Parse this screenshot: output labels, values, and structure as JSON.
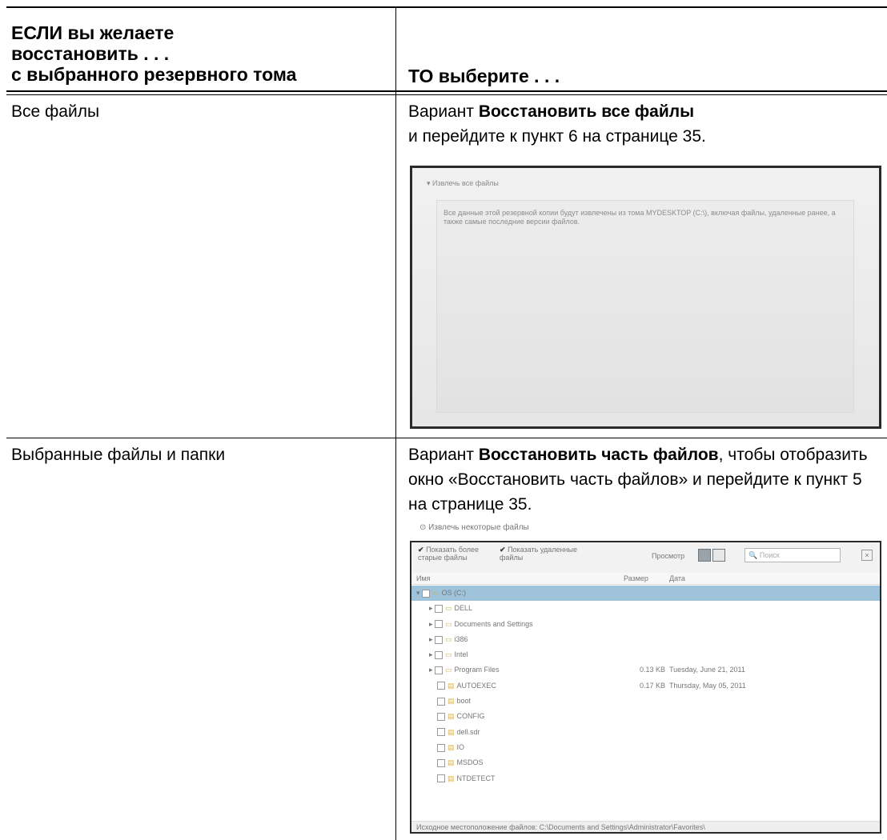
{
  "header": {
    "left_lines": [
      "ЕСЛИ вы желаете",
      "восстановить . . .",
      "с выбранного резервного тома"
    ],
    "right": "ТО выберите . . ."
  },
  "rows": [
    {
      "left": "Все файлы",
      "right_prefix": "Вариант ",
      "right_bold": "Восстановить все файлы",
      "right_suffix": "и перейдите к пункт 6 на странице 35."
    },
    {
      "left": "Выбранные файлы и папки",
      "right_prefix": "Вариант ",
      "right_bold": "Восстановить часть файлов",
      "right_suffix": ", чтобы отобразить окно «Восстановить часть файлов» и перейдите к пункт 5 на странице 35."
    }
  ],
  "screenshot_all": {
    "title": "Извлечь все файлы",
    "description": "Все данные этой резервной копии будут извлечены из тома MYDESKTOP (C:\\), включая файлы, удаленные ранее, а также самые последние версии файлов."
  },
  "screenshot_some": {
    "title": "Извлечь некоторые файлы",
    "checkbox_old": "Показать более старые файлы",
    "checkbox_deleted": "Показать удаленные файлы",
    "view_label": "Просмотр",
    "search_placeholder": "Поиск",
    "col_name": "Имя",
    "col_size": "Размер",
    "col_date": "Дата",
    "rows": [
      {
        "name": "OS (C:)",
        "size": "",
        "date": ""
      },
      {
        "name": "DELL",
        "size": "",
        "date": ""
      },
      {
        "name": "Documents and Settings",
        "size": "",
        "date": ""
      },
      {
        "name": "i386",
        "size": "",
        "date": ""
      },
      {
        "name": "Intel",
        "size": "",
        "date": ""
      },
      {
        "name": "Program Files",
        "size": "0.13 KB",
        "date": "Tuesday, June 21, 2011"
      },
      {
        "name": "AUTOEXEC",
        "size": "0.17 KB",
        "date": "Thursday, May 05, 2011"
      },
      {
        "name": "boot",
        "size": "",
        "date": ""
      },
      {
        "name": "CONFIG",
        "size": "",
        "date": ""
      },
      {
        "name": "dell.sdr",
        "size": "",
        "date": ""
      },
      {
        "name": "IO",
        "size": "",
        "date": ""
      },
      {
        "name": "MSDOS",
        "size": "",
        "date": ""
      },
      {
        "name": "NTDETECT",
        "size": "",
        "date": ""
      }
    ],
    "footer": "Исходное местоположение файлов: C:\\Documents and Settings\\Administrator\\Favorites\\"
  }
}
